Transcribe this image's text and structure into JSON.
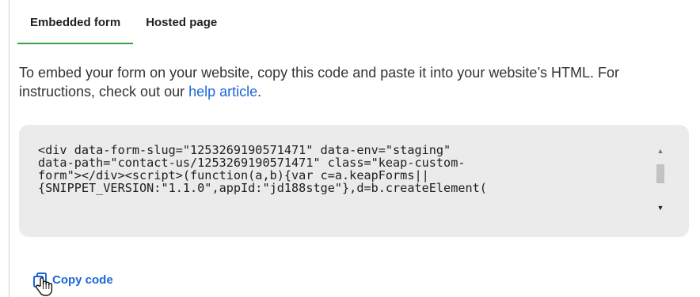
{
  "tabs": [
    {
      "label": "Embedded form",
      "active": true
    },
    {
      "label": "Hosted page",
      "active": false
    }
  ],
  "instructions": {
    "text": "To embed your form on your website, copy this code and paste it into your website’s HTML. For instructions, check out our ",
    "link_label": "help article",
    "end": "."
  },
  "code": {
    "lines": [
      "<div data-form-slug=\"1253269190571471\" data-env=\"staging\"",
      "data-path=\"contact-us/1253269190571471\" class=\"keap-custom-",
      "form\"></div><script>(function(a,b){var c=a.keapForms||",
      "{SNIPPET_VERSION:\"1.1.0\",appId:\"jd188stge\"},d=b.createElement("
    ]
  },
  "copy_button": {
    "label": "Copy code",
    "icon": "copy-icon"
  },
  "colors": {
    "accent_green": "#37a24a",
    "link_blue": "#1a66d9",
    "code_bg": "#ebebeb"
  }
}
